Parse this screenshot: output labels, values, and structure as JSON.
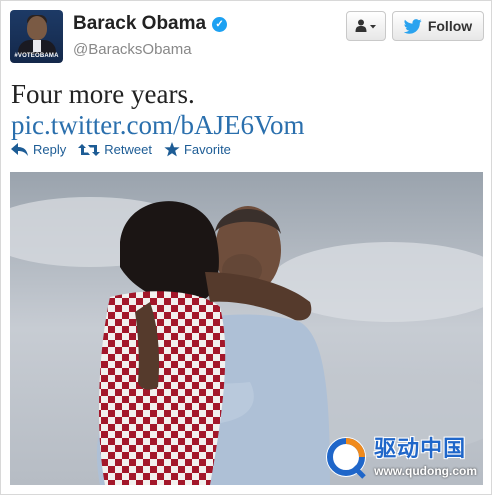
{
  "user": {
    "name": "Barack Obama",
    "handle": "@BaracksObama",
    "avatar_tag": "#VOTEOBAMA",
    "verified_color": "#1da1f2"
  },
  "buttons": {
    "user_menu_icon": "person-dropdown-icon",
    "follow_label": "Follow",
    "follow_icon": "bird-icon"
  },
  "tweet": {
    "text": "Four more years.",
    "link": "pic.twitter.com/bAJE6Vom"
  },
  "actions": [
    {
      "label": "Reply",
      "icon": "reply-icon"
    },
    {
      "label": "Retweet",
      "icon": "retweet-icon"
    },
    {
      "label": "Favorite",
      "icon": "star-icon"
    }
  ],
  "watermark": {
    "title": "驱动中国",
    "url": "www.qudong.com"
  },
  "colors": {
    "link": "#2a6fad",
    "action": "#1d5c95",
    "watermark": "#1f66c9"
  }
}
